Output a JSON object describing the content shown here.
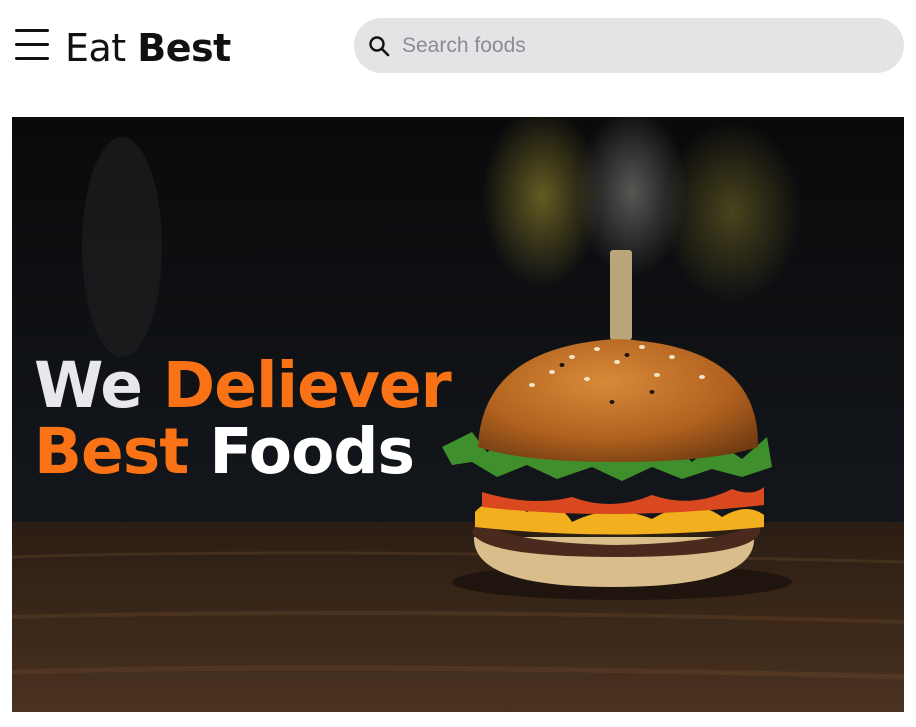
{
  "header": {
    "logo_part1": "Eat",
    "logo_part2": "Best",
    "search_placeholder": "Search foods"
  },
  "hero": {
    "line1_word1": "We",
    "line1_word2": "Deliever",
    "line2_word1": "Best",
    "line2_word2": "Foods"
  },
  "colors": {
    "accent": "#f97316",
    "search_bg": "#e4e4e7"
  },
  "icons": [
    "menu-icon",
    "search-icon"
  ]
}
